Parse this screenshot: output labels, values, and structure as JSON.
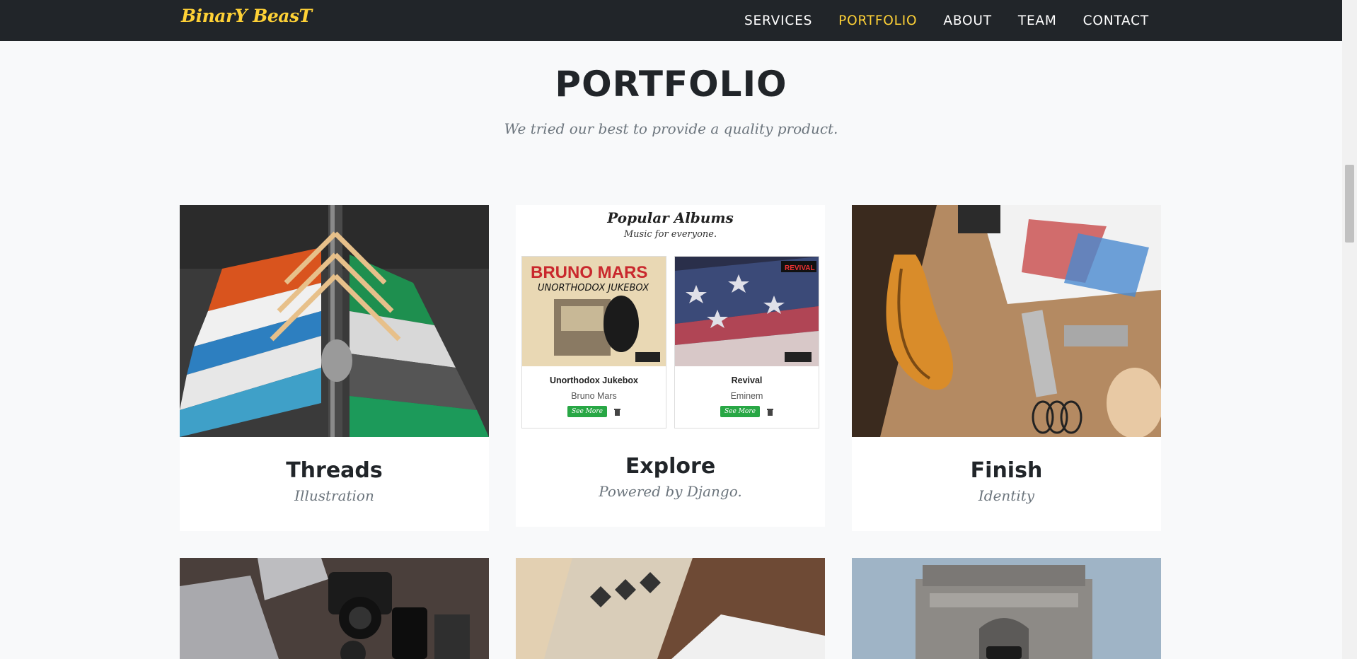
{
  "navbar": {
    "brand": "BinarY BeasT",
    "links": [
      {
        "label": "SERVICES",
        "active": false
      },
      {
        "label": "PORTFOLIO",
        "active": true
      },
      {
        "label": "ABOUT",
        "active": false
      },
      {
        "label": "TEAM",
        "active": false
      },
      {
        "label": "CONTACT",
        "active": false
      }
    ]
  },
  "portfolio": {
    "heading": "PORTFOLIO",
    "subheading": "We tried our best to provide a quality product.",
    "items": [
      {
        "title": "Threads",
        "subtitle": "Illustration"
      },
      {
        "title": "Explore",
        "subtitle": "Powered by Django."
      },
      {
        "title": "Finish",
        "subtitle": "Identity"
      }
    ],
    "preview": {
      "title": "Popular Albums",
      "subtitle": "Music for everyone.",
      "albums": [
        {
          "cover_text_1": "BRUNO MARS",
          "cover_text_2": "UNORTHODOX JUKEBOX",
          "name": "Unorthodox Jukebox",
          "artist": "Bruno Mars",
          "button": "See More"
        },
        {
          "cover_text_1": "REVIVAL",
          "name": "Revival",
          "artist": "Eminem",
          "button": "See More"
        }
      ]
    }
  },
  "colors": {
    "navbar_bg": "#212529",
    "accent": "#fed136",
    "page_bg": "#f8f9fa",
    "button_green": "#28a745"
  }
}
